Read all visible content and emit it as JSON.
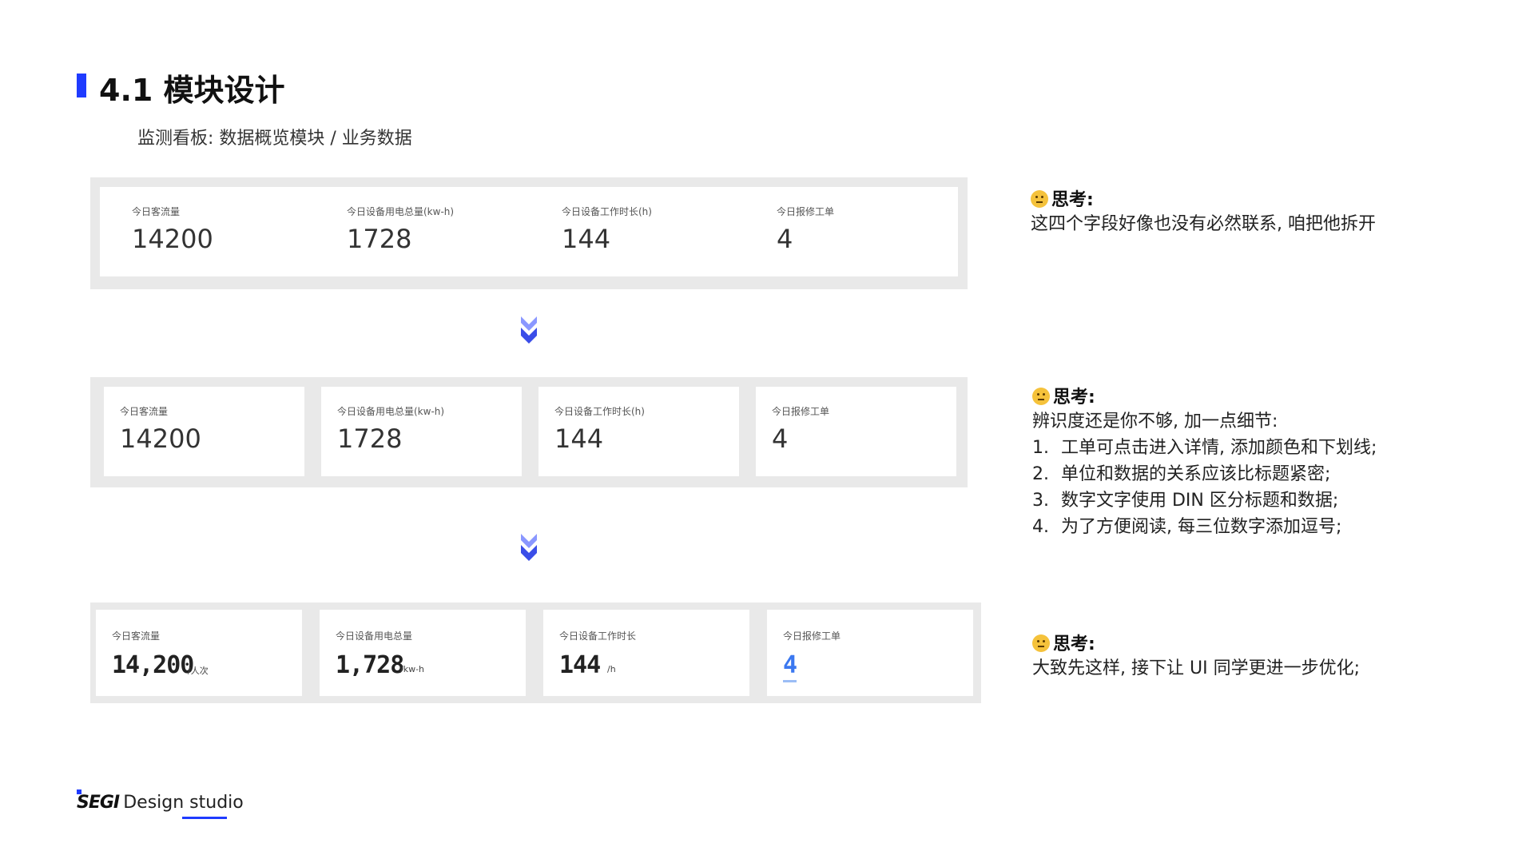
{
  "header": {
    "title": "4.1 模块设计",
    "subtitle": "监测看板: 数据概览模块 / 业务数据"
  },
  "panel1": {
    "items": [
      {
        "label": "今日客流量",
        "value": "14200"
      },
      {
        "label": "今日设备用电总量(kw-h)",
        "value": "1728"
      },
      {
        "label": "今日设备工作时长(h)",
        "value": "144"
      },
      {
        "label": "今日报修工单",
        "value": "4"
      }
    ]
  },
  "panel2": {
    "items": [
      {
        "label": "今日客流量",
        "value": "14200"
      },
      {
        "label": "今日设备用电总量(kw-h)",
        "value": "1728"
      },
      {
        "label": "今日设备工作时长(h)",
        "value": "144"
      },
      {
        "label": "今日报修工单",
        "value": "4"
      }
    ]
  },
  "panel3": {
    "items": [
      {
        "label": "今日客流量",
        "value": "14,200",
        "unit": "/人次"
      },
      {
        "label": "今日设备用电总量",
        "value": "1,728",
        "unit": "/kw-h"
      },
      {
        "label": "今日设备工作时长",
        "value": "144",
        "unit": "/h"
      },
      {
        "label": "今日报修工单",
        "value": "4",
        "unit": ""
      }
    ],
    "link_color": "#3b78f0"
  },
  "notes": [
    {
      "title": "思考:",
      "lines": [
        "这四个字段好像也没有必然联系, 咱把他拆开"
      ]
    },
    {
      "title": "思考:",
      "intro": "辨识度还是你不够, 加一点细节:",
      "items": [
        {
          "num": "1.",
          "text": "工单可点击进入详情, 添加颜色和下划线;"
        },
        {
          "num": "2.",
          "text": "单位和数据的关系应该比标题紧密;"
        },
        {
          "num": "3.",
          "text": "数字文字使用 DIN 区分标题和数据;"
        },
        {
          "num": "4.",
          "text": "为了方便阅读, 每三位数字添加逗号;"
        }
      ]
    },
    {
      "title": "思考:",
      "lines": [
        "大致先这样, 接下让 UI 同学更进一步优化;"
      ]
    }
  ],
  "footer": {
    "brand": "SEGI",
    "studio": "Design studio"
  },
  "colors": {
    "accent": "#1f3bff",
    "arrow": "#4a5cf0",
    "panel_bg": "#e9e9e9"
  },
  "icons": [
    "chevron-double-down-icon",
    "thinking-face-icon"
  ]
}
